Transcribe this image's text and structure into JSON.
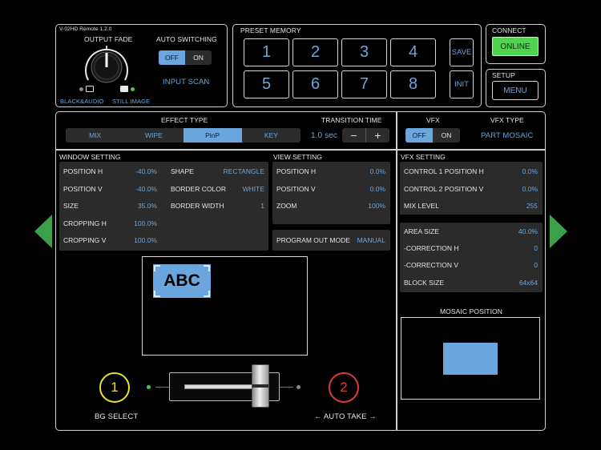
{
  "app": {
    "version": "V-02HD Remote 1.2.0"
  },
  "fade": {
    "title": "OUTPUT FADE",
    "left_label": "BLACK&AUDIO",
    "right_label": "STILL IMAGE"
  },
  "auto_switching": {
    "title": "AUTO SWITCHING",
    "off": "OFF",
    "on": "ON",
    "selected": "OFF",
    "input_scan": "INPUT SCAN"
  },
  "preset": {
    "title": "PRESET MEMORY",
    "buttons": [
      "1",
      "2",
      "3",
      "4",
      "5",
      "6",
      "7",
      "8"
    ],
    "save": "SAVE",
    "init": "INIT"
  },
  "connect": {
    "title": "CONNECT",
    "button": "ONLINE",
    "button_color": "#4fd44f"
  },
  "setup": {
    "title": "SETUP",
    "button": "MENU"
  },
  "effect": {
    "title": "EFFECT TYPE",
    "options": [
      "MIX",
      "WIPE",
      "PinP",
      "KEY"
    ],
    "selected": "PinP"
  },
  "transition": {
    "title": "TRANSITION TIME",
    "value": "1.0 sec",
    "minus": "−",
    "plus": "+"
  },
  "vfx": {
    "title": "VFX",
    "off": "OFF",
    "on": "ON",
    "selected": "OFF",
    "type_title": "VFX TYPE",
    "type_value": "PART MOSAIC"
  },
  "window_setting": {
    "title": "WINDOW SETTING",
    "left": [
      {
        "k": "POSITION H",
        "v": "-40.0%"
      },
      {
        "k": "POSITION V",
        "v": "-40.0%"
      },
      {
        "k": "SIZE",
        "v": "35.0%"
      },
      {
        "k": "CROPPING H",
        "v": "100.0%"
      },
      {
        "k": "CROPPING V",
        "v": "100.0%"
      }
    ],
    "right": [
      {
        "k": "SHAPE",
        "v": "RECTANGLE"
      },
      {
        "k": "BORDER COLOR",
        "v": "WHITE"
      },
      {
        "k": "BORDER WIDTH",
        "v": "1"
      }
    ]
  },
  "view_setting": {
    "title": "VIEW SETTING",
    "rows": [
      {
        "k": "POSITION H",
        "v": "0.0%"
      },
      {
        "k": "POSITION V",
        "v": "0.0%"
      },
      {
        "k": "ZOOM",
        "v": "100%"
      }
    ],
    "program_out_label": "PROGRAM OUT MODE",
    "program_out_value": "MANUAL"
  },
  "vfx_setting": {
    "title": "VFX SETTING",
    "rows1": [
      {
        "k": "CONTROL 1 POSITION H",
        "v": "0.0%"
      },
      {
        "k": "CONTROL 2 POSITION V",
        "v": "0.0%"
      },
      {
        "k": "MIX LEVEL",
        "v": "255"
      }
    ],
    "rows2": [
      {
        "k": "AREA SIZE",
        "v": "40.0%"
      },
      {
        "k": "-CORRECTION H",
        "v": "0"
      },
      {
        "k": "-CORRECTION V",
        "v": "0"
      },
      {
        "k": "BLOCK SIZE",
        "v": "64x64"
      }
    ]
  },
  "preview": {
    "pip_text": "ABC"
  },
  "mosaic": {
    "title": "MOSAIC POSITION"
  },
  "bottom": {
    "bg_num": "1",
    "bg_label": "BG SELECT",
    "take_num": "2",
    "take_label": "← AUTO TAKE →"
  },
  "colors": {
    "accent": "#6aa6dd",
    "yellow": "#e6e22a",
    "red": "#e23a3a",
    "green": "#3bb54a"
  }
}
